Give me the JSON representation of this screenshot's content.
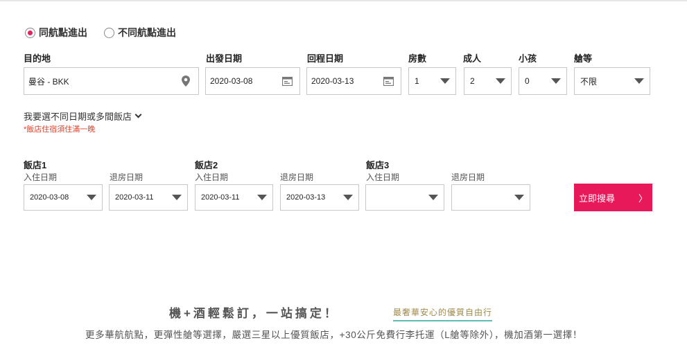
{
  "trip": {
    "radio_same": "同航點進出",
    "radio_diff": "不同航點進出"
  },
  "labels": {
    "destination": "目的地",
    "depart": "出發日期",
    "return": "回程日期",
    "rooms": "房數",
    "adults": "成人",
    "children": "小孩",
    "cabin": "艙等"
  },
  "values": {
    "destination": "曼谷 - BKK",
    "depart": "2020-03-08",
    "return": "2020-03-13",
    "rooms": "1",
    "adults": "2",
    "children": "0",
    "cabin": "不限"
  },
  "multi_link": "我要選不同日期或多間飯店",
  "note": "*飯店住宿須住滿一晚",
  "hotels": [
    {
      "name": "飯店1",
      "checkin_label": "入住日期",
      "checkout_label": "退房日期",
      "checkin": "2020-03-08",
      "checkout": "2020-03-11"
    },
    {
      "name": "飯店2",
      "checkin_label": "入住日期",
      "checkout_label": "退房日期",
      "checkin": "2020-03-11",
      "checkout": "2020-03-13"
    },
    {
      "name": "飯店3",
      "checkin_label": "入住日期",
      "checkout_label": "退房日期",
      "checkin": "",
      "checkout": ""
    }
  ],
  "search_button": "立即搜尋",
  "search_arrow": "〉",
  "promo": {
    "title": "機+酒輕鬆訂，一站搞定！",
    "tag": "最奢華安心的優質自由行",
    "desc": "更多華航航點，更彈性艙等選擇，嚴選三星以上優質飯店，+30公斤免費行李托運（L艙等除外），機加酒第一選擇！"
  },
  "icons": {
    "location": "location-pin-icon",
    "calendar": "calendar-icon",
    "dropdown": "chevron-down-icon"
  },
  "colors": {
    "accent": "#e8195a",
    "note": "#e0402a",
    "tag_underline": "#5fbcb0"
  }
}
